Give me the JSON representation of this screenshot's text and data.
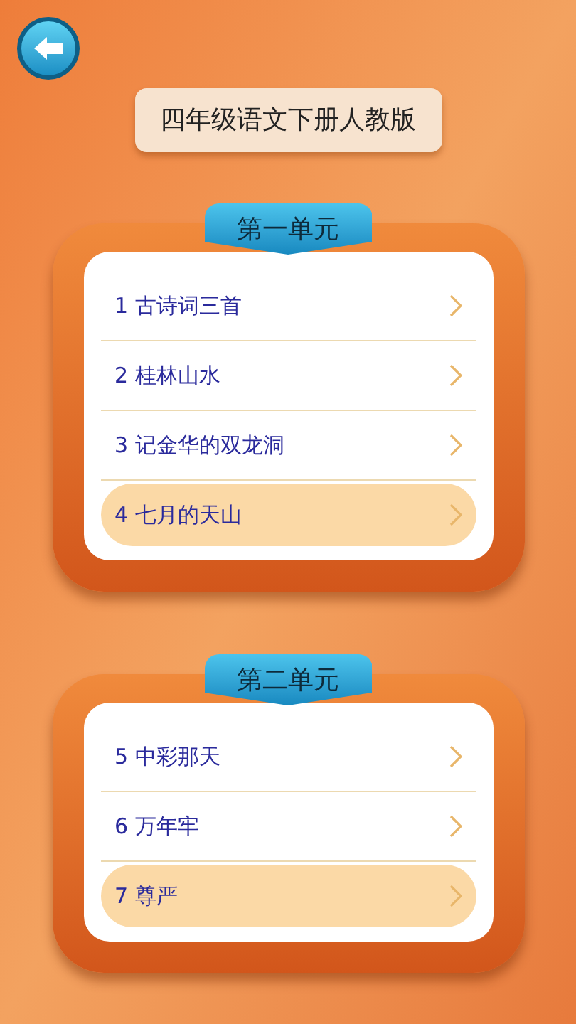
{
  "title": "四年级语文下册人教版",
  "units": [
    {
      "title": "第一单元",
      "lessons": [
        {
          "label": "1 古诗词三首",
          "selected": false
        },
        {
          "label": "2 桂林山水",
          "selected": false
        },
        {
          "label": "3 记金华的双龙洞",
          "selected": false
        },
        {
          "label": "4 七月的天山",
          "selected": true
        }
      ]
    },
    {
      "title": "第二单元",
      "lessons": [
        {
          "label": "5 中彩那天",
          "selected": false
        },
        {
          "label": "6 万年牢",
          "selected": false
        },
        {
          "label": "7 尊严",
          "selected": true
        }
      ]
    }
  ]
}
